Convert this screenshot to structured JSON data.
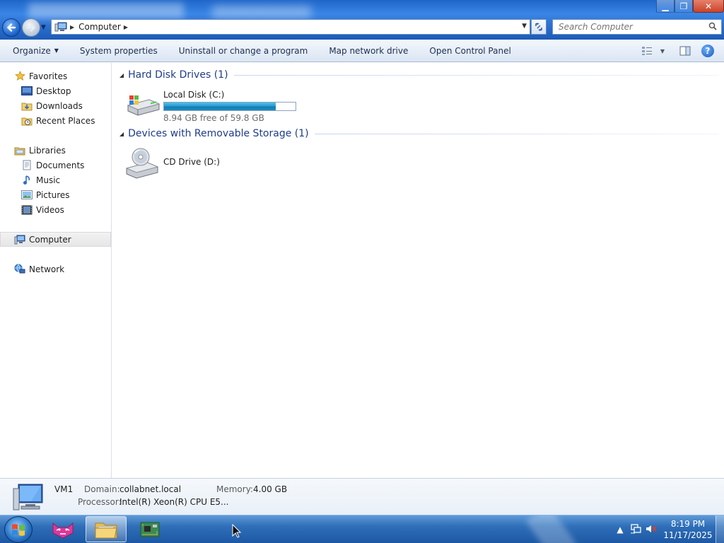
{
  "window": {
    "minimize_glyph": "▁",
    "maximize_glyph": "❐",
    "close_glyph": "✕"
  },
  "navigation": {
    "back_icon": "back-arrow-icon",
    "forward_icon": "forward-arrow-icon",
    "address_path": "Computer",
    "search_placeholder": "Search Computer"
  },
  "toolbar": {
    "organize": "Organize",
    "system_properties": "System properties",
    "uninstall": "Uninstall or change a program",
    "map_network_drive": "Map network drive",
    "open_control_panel": "Open Control Panel",
    "help_glyph": "?"
  },
  "sidebar": {
    "favorites": {
      "label": "Favorites",
      "items": [
        {
          "label": "Desktop",
          "icon": "desktop-icon"
        },
        {
          "label": "Downloads",
          "icon": "downloads-folder-icon"
        },
        {
          "label": "Recent Places",
          "icon": "recent-places-icon"
        }
      ]
    },
    "libraries": {
      "label": "Libraries",
      "items": [
        {
          "label": "Documents",
          "icon": "documents-icon"
        },
        {
          "label": "Music",
          "icon": "music-icon"
        },
        {
          "label": "Pictures",
          "icon": "pictures-icon"
        },
        {
          "label": "Videos",
          "icon": "videos-icon"
        }
      ]
    },
    "computer": {
      "label": "Computer",
      "selected": true
    },
    "network": {
      "label": "Network"
    }
  },
  "content": {
    "groups": [
      {
        "title": "Hard Disk Drives (1)",
        "drives": [
          {
            "name": "Local Disk (C:)",
            "free_text": "8.94 GB free of 59.8 GB",
            "used_fraction": 0.85,
            "icon": "hard-disk-icon"
          }
        ]
      },
      {
        "title": "Devices with Removable Storage (1)",
        "drives": [
          {
            "name": "CD Drive (D:)",
            "icon": "cd-drive-icon"
          }
        ]
      }
    ]
  },
  "details": {
    "computer_name": "VM1",
    "domain_label": "Domain:",
    "domain_value": "collabnet.local",
    "memory_label": "Memory:",
    "memory_value": "4.00 GB",
    "processor_label": "Processor:",
    "processor_value": "Intel(R) Xeon(R) CPU E5..."
  },
  "taskbar": {
    "apps": [
      {
        "name": "paint-app",
        "icon": "cat-app-icon",
        "active": false
      },
      {
        "name": "explorer",
        "icon": "folder-icon",
        "active": true
      },
      {
        "name": "system-app",
        "icon": "circuit-board-icon",
        "active": false
      }
    ],
    "clock_time": "8:19 PM",
    "clock_date": "11/17/2025"
  },
  "colors": {
    "title_gradient_top": "#1f66c9",
    "group_title": "#1e3c8c",
    "capacity_fill": "#2a9cd1",
    "taskbar": "#2f6eb8"
  }
}
